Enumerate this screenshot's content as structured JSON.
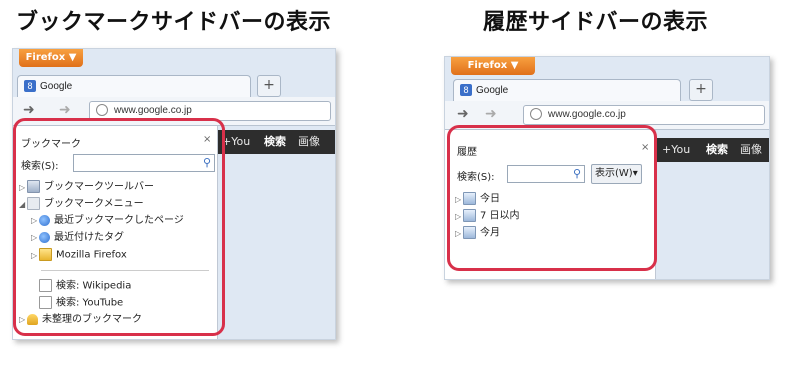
{
  "captions": {
    "left": "ブックマークサイドバーの表示",
    "right": "履歴サイドバーの表示"
  },
  "colors": {
    "highlight": "#d8304a",
    "firefox_button": "#e97a22",
    "page_bar": "#2d2d2d"
  },
  "left_shot": {
    "firefox_button": "Firefox ▼",
    "tab_title": "Google",
    "new_tab": "+",
    "url": "www.google.co.jp",
    "nav_back_icon": "arrow-left-icon",
    "nav_forward_icon": "arrow-right-icon",
    "sidebar": {
      "title": "ブックマーク",
      "close": "×",
      "search_label": "検索(S):",
      "search_value": "",
      "tree": [
        {
          "label": "ブックマークツールバー",
          "icon": "toolbar-folder-icon"
        },
        {
          "label": "ブックマークメニュー",
          "icon": "menu-folder-icon"
        },
        {
          "label": "最近ブックマークしたページ",
          "icon": "smart-folder-icon"
        },
        {
          "label": "最近付けたタグ",
          "icon": "smart-folder-icon"
        },
        {
          "label": "Mozilla Firefox",
          "icon": "folder-icon"
        },
        {
          "label": "検索: Wikipedia",
          "icon": "bookmark-icon"
        },
        {
          "label": "検索: YouTube",
          "icon": "bookmark-icon"
        },
        {
          "label": "未整理のブックマーク",
          "icon": "unsorted-folder-icon"
        }
      ]
    },
    "page_bar": [
      "+You",
      "検索",
      "画像"
    ]
  },
  "right_shot": {
    "firefox_button": "Firefox ▼",
    "tab_title": "Google",
    "new_tab": "+",
    "url": "www.google.co.jp",
    "sidebar": {
      "title": "履歴",
      "close": "×",
      "search_label": "検索(S):",
      "search_value": "",
      "view_button": "表示(W)▾",
      "tree": [
        {
          "label": "今日",
          "icon": "history-folder-icon"
        },
        {
          "label": "7 日以内",
          "icon": "history-folder-icon"
        },
        {
          "label": "今月",
          "icon": "history-folder-icon"
        }
      ]
    },
    "page_bar": [
      "+You",
      "検索",
      "画像"
    ]
  }
}
